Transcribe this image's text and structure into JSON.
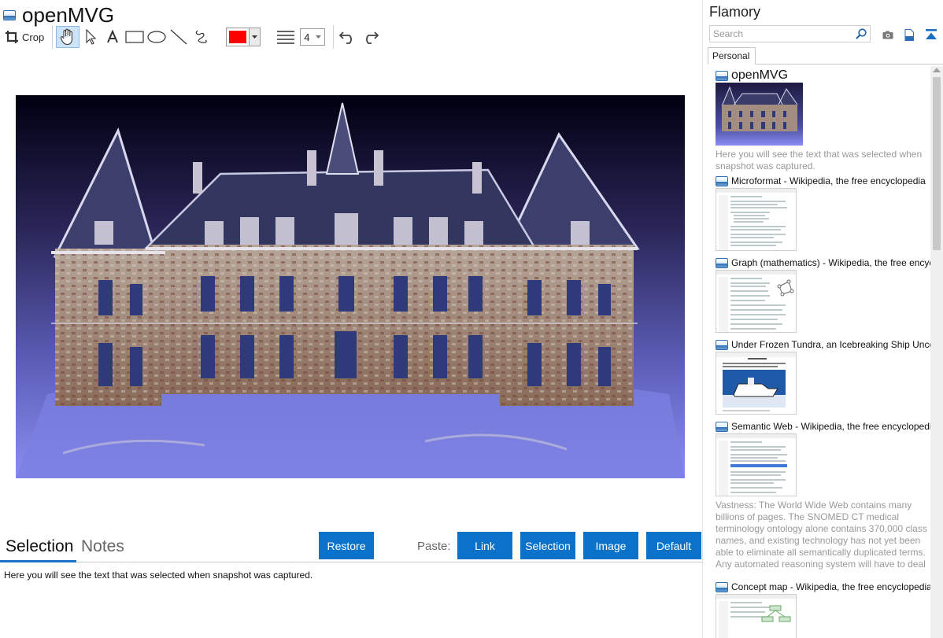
{
  "window": {
    "title": "openMVG"
  },
  "toolbar": {
    "crop_label": "Crop",
    "pen_color": "#ff0000",
    "line_width": "4",
    "tools": [
      "hand-icon",
      "pointer-icon",
      "text-icon",
      "rectangle-icon",
      "ellipse-icon",
      "line-icon",
      "freehand-icon",
      "undo-icon",
      "redo-icon"
    ]
  },
  "bottom": {
    "tabs": [
      "Selection",
      "Notes"
    ],
    "restore_label": "Restore",
    "paste_label": "Paste:",
    "paste_buttons": [
      "Link",
      "Selection",
      "Image",
      "Default"
    ],
    "selection_text": "Here you will see the text that was selected when snapshot was captured."
  },
  "sidebar": {
    "app_name": "Flamory",
    "search_placeholder": "Search",
    "tab": "Personal",
    "items": [
      {
        "title": "openMVG",
        "desc": "Here you will see the text that was selected when snapshot was captured."
      },
      {
        "title": "Microformat - Wikipedia, the free encyclopedia"
      },
      {
        "title": "Graph (mathematics) - Wikipedia, the free encyclopedia"
      },
      {
        "title": "Under Frozen Tundra, an Icebreaking Ship Uncovers"
      },
      {
        "title": "Semantic Web - Wikipedia, the free encyclopedia",
        "desc": "Vastness: The World Wide Web contains many billions of pages. The SNOMED CT medical terminology ontology alone contains 370,000 class names, and existing technology has not yet been able to eliminate all semantically duplicated terms. Any automated reasoning system will have to deal with truly huge inputs."
      },
      {
        "title": "Concept map - Wikipedia, the free encyclopedia"
      }
    ]
  },
  "colors": {
    "accent": "#0a73c9",
    "tab_underline": "#1a73c8"
  }
}
